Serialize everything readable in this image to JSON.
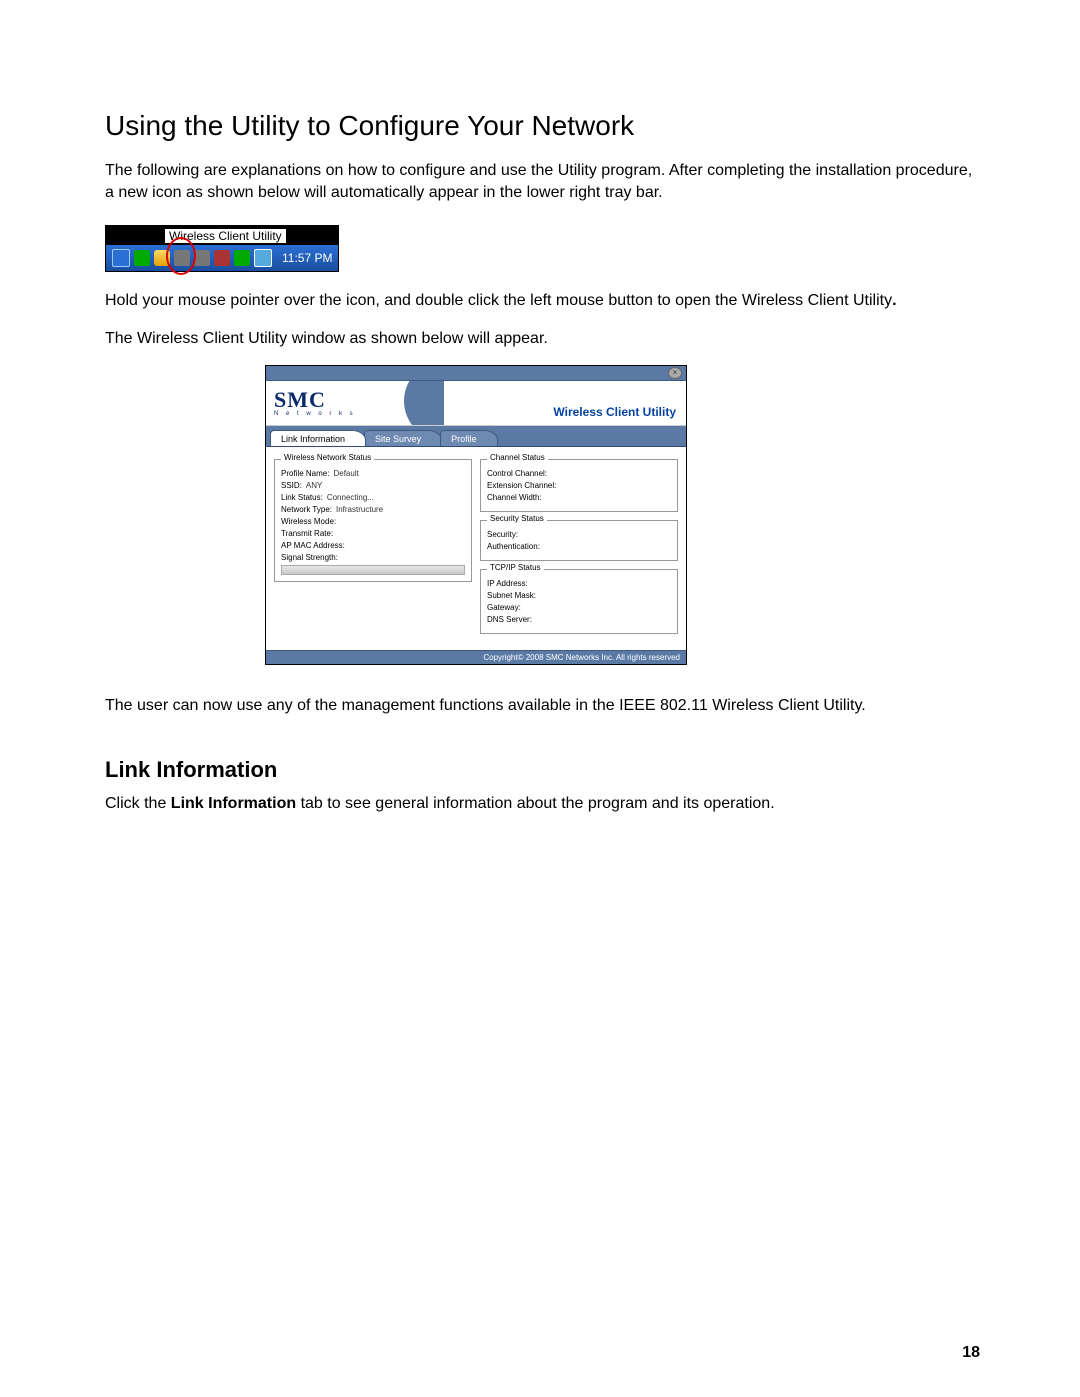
{
  "doc": {
    "heading": "Using the Utility to Configure Your Network",
    "p1": "The following are explanations on how to configure and use the Utility program. After completing the installation procedure, a new icon as shown below will automatically appear in the lower right tray bar.",
    "p2_a": "Hold your mouse pointer over the icon, and double click the left mouse button to open the Wireless Client Utility",
    "p2_b": ".",
    "p3": "The Wireless Client Utility window as shown below will appear.",
    "p4": "The user can now use any of the management functions available in the IEEE 802.11 Wireless Client Utility.",
    "sub_heading": "Link Information",
    "p5_a": "Click the ",
    "p5_b": "Link Information",
    "p5_c": " tab to see general information about the program and its operation.",
    "page_number": "18"
  },
  "tray": {
    "tooltip": "Wireless Client Utility",
    "time": "11:57 PM"
  },
  "util": {
    "logo": "SMC",
    "logo_sub": "N e t w o r k s",
    "title": "Wireless Client Utility",
    "tabs": {
      "link": "Link Information",
      "survey": "Site Survey",
      "profile": "Profile"
    },
    "close_glyph": "×",
    "wns": {
      "legend": "Wireless Network Status",
      "profile_name_l": "Profile Name",
      "profile_name_v": "Default",
      "ssid_l": "SSID",
      "ssid_v": "ANY",
      "link_status_l": "Link Status",
      "link_status_v": "Connecting...",
      "network_type_l": "Network Type",
      "network_type_v": "Infrastructure",
      "wireless_mode_l": "Wireless Mode",
      "wireless_mode_v": "",
      "transmit_rate_l": "Transmit Rate",
      "transmit_rate_v": "",
      "ap_mac_l": "AP MAC Address",
      "ap_mac_v": "",
      "signal_l": "Signal Strength",
      "signal_v": ""
    },
    "chan": {
      "legend": "Channel Status",
      "control_l": "Control Channel",
      "control_v": "",
      "ext_l": "Extension Channel",
      "ext_v": "",
      "width_l": "Channel Width",
      "width_v": ""
    },
    "sec": {
      "legend": "Security Status",
      "security_l": "Security",
      "security_v": "",
      "auth_l": "Authentication",
      "auth_v": ""
    },
    "tcp": {
      "legend": "TCP/IP Status",
      "ip_l": "IP Address",
      "ip_v": "",
      "mask_l": "Subnet Mask",
      "mask_v": "",
      "gw_l": "Gateway",
      "gw_v": "",
      "dns_l": "DNS Server",
      "dns_v": ""
    },
    "footer": "Copyright© 2008 SMC Networks Inc. All rights reserved"
  }
}
